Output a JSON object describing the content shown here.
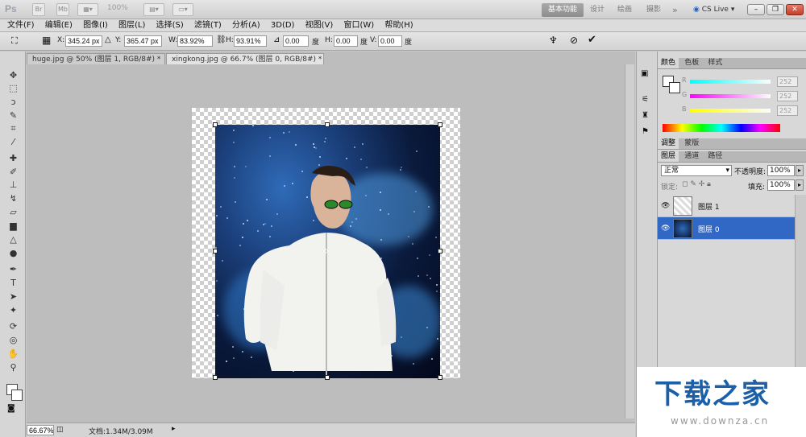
{
  "app": {
    "logo": "Ps",
    "zoom_preset": "100%",
    "workspaces": [
      "基本功能",
      "设计",
      "绘画",
      "摄影"
    ],
    "more": "»",
    "cs_live": "CS Live"
  },
  "menu": [
    "文件(F)",
    "编辑(E)",
    "图像(I)",
    "图层(L)",
    "选择(S)",
    "滤镜(T)",
    "分析(A)",
    "3D(D)",
    "视图(V)",
    "窗口(W)",
    "帮助(H)"
  ],
  "options": {
    "x_label": "X:",
    "x_value": "345.24 px",
    "y_label": "Y:",
    "y_value": "365.47 px",
    "w_label": "W:",
    "w_value": "83.92%",
    "h_label": "H:",
    "h_value": "93.91%",
    "angle_value": "0.00",
    "angle_unit": "度",
    "hskew_label": "H:",
    "hskew_value": "0.00",
    "hskew_unit": "度",
    "vskew_label": "V:",
    "vskew_value": "0.00",
    "vskew_unit": "度"
  },
  "tabs": [
    {
      "label": "huge.jpg @ 50% (图层 1, RGB/8#) *",
      "close": "×"
    },
    {
      "label": "xingkong.jpg @ 66.7% (图层 0, RGB/8#) *",
      "close": "×"
    }
  ],
  "status": {
    "zoom": "66.67%",
    "doc": "文档:1.34M/3.09M"
  },
  "color_panel": {
    "tabs": [
      "颜色",
      "色板",
      "样式"
    ],
    "rows": [
      {
        "label": "R",
        "value": "252"
      },
      {
        "label": "G",
        "value": "252"
      },
      {
        "label": "B",
        "value": "252"
      }
    ]
  },
  "adjust_panel": {
    "tabs": [
      "调整",
      "蒙版"
    ]
  },
  "layers_panel": {
    "tabs": [
      "图层",
      "通道",
      "路径"
    ],
    "blend_mode": "正常",
    "opacity_label": "不透明度:",
    "opacity_value": "100%",
    "lock_label": "锁定:",
    "fill_label": "填充:",
    "fill_value": "100%",
    "layers": [
      {
        "name": "图层 1",
        "selected": false
      },
      {
        "name": "图层 0",
        "selected": true
      }
    ]
  },
  "watermark": {
    "title": "下载之家",
    "url": "www.downza.cn"
  },
  "colors": {
    "selection": "#3168c6",
    "space": "#0a1a3c",
    "watermark": "#1b5fa8"
  }
}
